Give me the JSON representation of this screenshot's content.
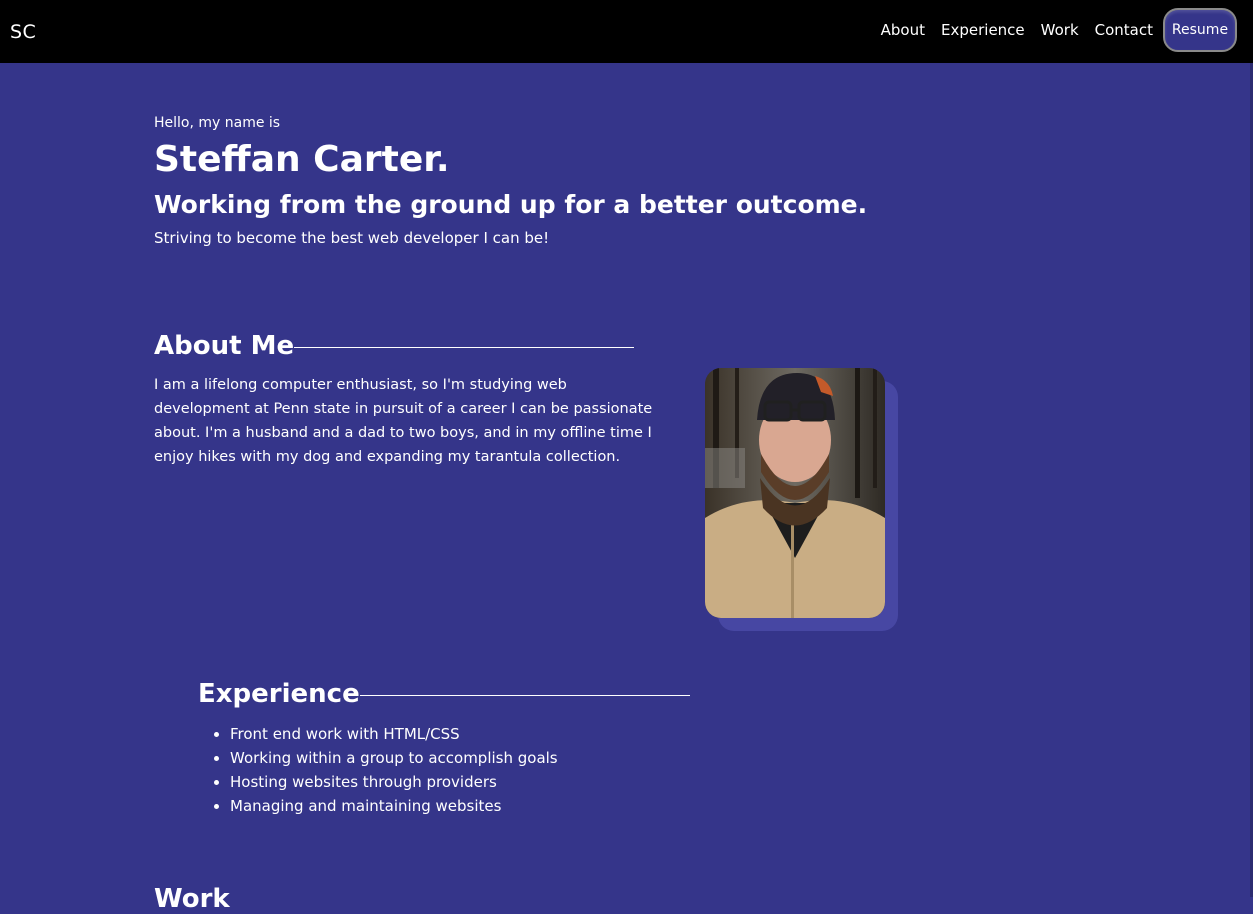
{
  "nav": {
    "logo": "SC",
    "links": [
      "About",
      "Experience",
      "Work",
      "Contact"
    ],
    "resume_label": "Resume"
  },
  "hero": {
    "greeting": "Hello, my name is",
    "name": "Steffan Carter.",
    "tagline": "Working from the ground up for a better outcome.",
    "subline": "Striving to become the best web developer I can be!"
  },
  "about": {
    "heading": "About Me",
    "text": "I am a lifelong computer enthusiast, so I'm studying web development at Penn state in pursuit of a career I can be passionate about. I'm a husband and a dad to two boys, and in my offline time I enjoy hikes with my dog and expanding my tarantula collection."
  },
  "experience": {
    "heading": "Experience",
    "items": [
      "Front end work with HTML/CSS",
      "Working within a group to accomplish goals",
      "Hosting websites through providers",
      "Managing and maintaining websites"
    ]
  },
  "work": {
    "heading": "Work"
  },
  "colors": {
    "background": "#35358a",
    "navbar": "#000000",
    "text": "#ffffff"
  }
}
